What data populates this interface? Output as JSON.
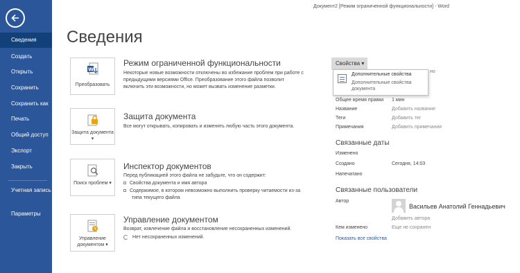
{
  "window": {
    "title": "Документ2 [Режим ограниченной функциональности] - Word"
  },
  "sidebar": {
    "items": [
      {
        "label": "Сведения"
      },
      {
        "label": "Создать"
      },
      {
        "label": "Открыть"
      },
      {
        "label": "Сохранить"
      },
      {
        "label": "Сохранить как"
      },
      {
        "label": "Печать"
      },
      {
        "label": "Общий доступ"
      },
      {
        "label": "Экспорт"
      },
      {
        "label": "Закрыть"
      },
      {
        "label": "Учетная запись"
      },
      {
        "label": "Параметры"
      }
    ]
  },
  "page": {
    "title": "Сведения"
  },
  "sections": {
    "compat": {
      "button": "Преобразовать",
      "title": "Режим ограниченной функциональности",
      "text": "Некоторые новые возможности отключены во избежание проблем при работе с предыдущими версиями Office. Преобразование этого файла позволит включить эти возможности, но может вызвать изменение разметки."
    },
    "protect": {
      "button": "Защита документа",
      "title": "Защита документа",
      "text": "Все могут открывать, копировать и изменять любую часть этого документа."
    },
    "inspect": {
      "button": "Поиск проблем",
      "title": "Инспектор документов",
      "text": "Перед публикацией этого файла не забудьте, что он содержит:",
      "bullet1": "Свойства документа и имя автора",
      "bullet2": "Содержимое, в котором невозможно выполнить проверку читаемости из-за типа текущего файла"
    },
    "manage": {
      "button": "Управление документом",
      "title": "Управление документом",
      "text": "Возврат, извлечение файла и восстановление несохраненных изменений.",
      "status": "Нет несохраненных изменений."
    }
  },
  "properties": {
    "button_label": "Свойства",
    "dropdown_title": "Дополнительные свойства",
    "dropdown_desc": "Дополнительные свойства документа",
    "peek": "но",
    "rows": [
      {
        "label": "Общее время правки",
        "value": "1 мин"
      },
      {
        "label": "Название",
        "value": "Добавить название"
      },
      {
        "label": "Теги",
        "value": "Добавить тег"
      },
      {
        "label": "Примечания",
        "value": "Добавить примечания"
      }
    ]
  },
  "dates": {
    "heading": "Связанные даты",
    "changed_label": "Изменено",
    "created_label": "Создано",
    "created_value": "Сегодня, 14:03",
    "printed_label": "Напечатано"
  },
  "people": {
    "heading": "Связанные пользователи",
    "author_label": "Автор",
    "author_name": "Васильев Анатолий Геннадьевич",
    "add_author": "Добавить автора",
    "modified_label": "Кем изменено",
    "modified_value": "Еще не сохранен"
  },
  "links": {
    "show_all": "Показать все свойства"
  },
  "colors": {
    "sidebar": "#2b579a",
    "sidebar_active": "#124078",
    "link": "#2b579a"
  }
}
